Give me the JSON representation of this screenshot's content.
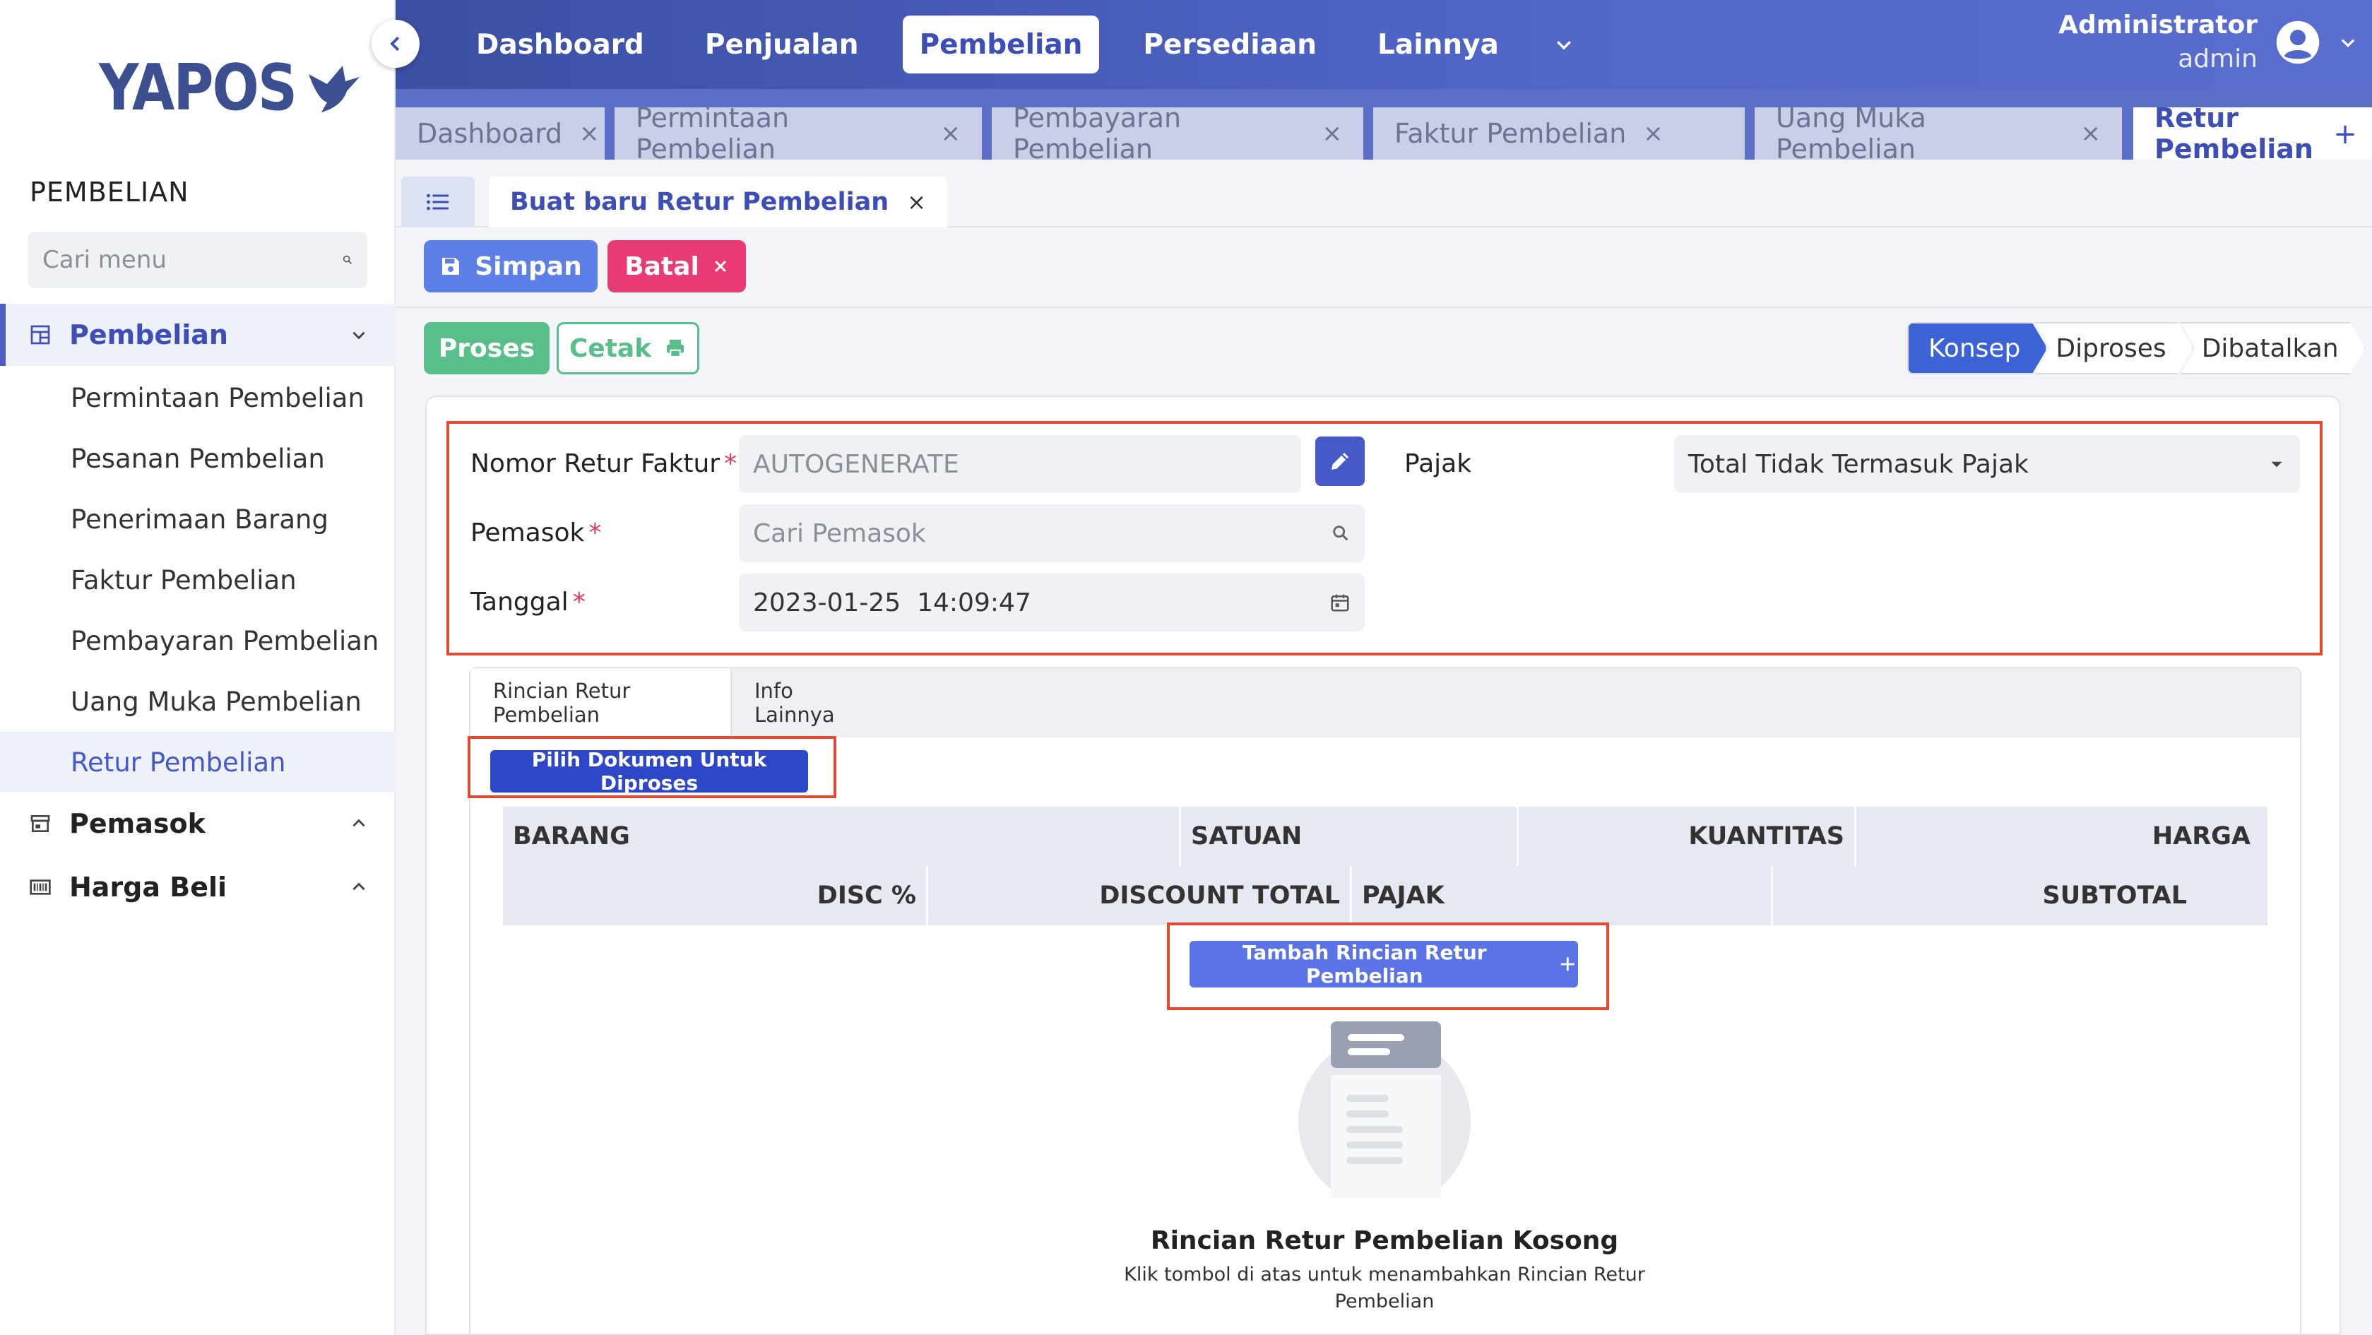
{
  "app": {
    "logo_text": "YAPOS",
    "brand_color": "#3b4f91",
    "accent_color": "#4559c9"
  },
  "sidebar": {
    "heading": "PEMBELIAN",
    "search_placeholder": "Cari menu",
    "groups": [
      {
        "label": "Pembelian",
        "icon": "grid-icon",
        "expanded": true
      },
      {
        "label": "Pemasok",
        "icon": "store-icon",
        "expanded": false
      },
      {
        "label": "Harga Beli",
        "icon": "barcode-icon",
        "expanded": false
      }
    ],
    "items": [
      "Permintaan Pembelian",
      "Pesanan Pembelian",
      "Penerimaan Barang",
      "Faktur Pembelian",
      "Pembayaran Pembelian",
      "Uang Muka Pembelian",
      "Retur Pembelian"
    ],
    "active_item": "Retur Pembelian"
  },
  "topnav": {
    "items": [
      "Dashboard",
      "Penjualan",
      "Pembelian",
      "Persediaan",
      "Lainnya"
    ],
    "active": "Pembelian",
    "user_name": "Administrator",
    "user_role": "admin"
  },
  "tabs": {
    "items": [
      "Dashboard",
      "Permintaan Pembelian",
      "Pembayaran Pembelian",
      "Faktur Pembelian",
      "Uang Muka Pembelian",
      "Retur Pembelian"
    ],
    "active": "Retur Pembelian",
    "close_glyph": "×",
    "add_glyph": "+"
  },
  "subheader": {
    "doc_tab_label": "Buat baru Retur Pembelian"
  },
  "actions": {
    "simpan": "Simpan",
    "batal": "Batal",
    "proses": "Proses",
    "cetak": "Cetak"
  },
  "status_steps": [
    "Konsep",
    "Diproses",
    "Dibatalkan"
  ],
  "status_active": "Konsep",
  "form": {
    "nomor_label": "Nomor Retur Faktur",
    "nomor_placeholder": "AUTOGENERATE",
    "pemasok_label": "Pemasok",
    "pemasok_placeholder": "Cari Pemasok",
    "tanggal_label": "Tanggal",
    "tanggal_value": "2023-01-25  14:09:47",
    "pajak_label": "Pajak",
    "pajak_value": "Total Tidak Termasuk Pajak",
    "required_mark": "*"
  },
  "detail": {
    "tabs": [
      "Rincian Retur Pembelian",
      "Info Lainnya"
    ],
    "active_tab": "Rincian Retur Pembelian",
    "pilih_button": "Pilih Dokumen Untuk Diproses",
    "columns_row1": [
      "BARANG",
      "SATUAN",
      "KUANTITAS",
      "HARGA"
    ],
    "columns_row2": [
      "DISC %",
      "DISCOUNT TOTAL",
      "PAJAK",
      "SUBTOTAL"
    ],
    "tambah_button": "Tambah Rincian Retur Pembelian",
    "empty_title": "Rincian Retur Pembelian Kosong",
    "empty_desc": "Klik tombol di atas untuk menambahkan Rincian Retur Pembelian"
  }
}
